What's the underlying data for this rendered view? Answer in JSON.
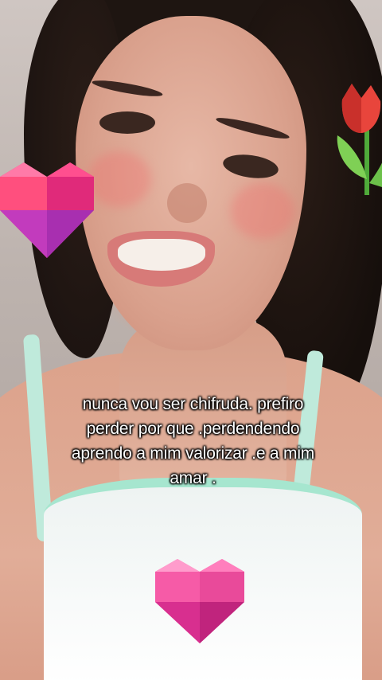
{
  "caption": {
    "lines": [
      "nunca vou ser chifruda. prefiro",
      "perder  por que .perdendendo",
      "aprendo a mim valorizar .e a mim",
      "amar ."
    ]
  },
  "stickers": {
    "heart_left": {
      "icon": "heart-icon",
      "colors": [
        "#ff3b6b",
        "#c23bbd",
        "#ff7aa8"
      ]
    },
    "heart_bottom": {
      "icon": "heart-icon",
      "colors": [
        "#ff5fa8",
        "#d82f8f",
        "#ff9ccc"
      ]
    },
    "tulip": {
      "icon": "tulip-icon",
      "colors": [
        "#e8453c",
        "#6cc04a"
      ]
    }
  }
}
